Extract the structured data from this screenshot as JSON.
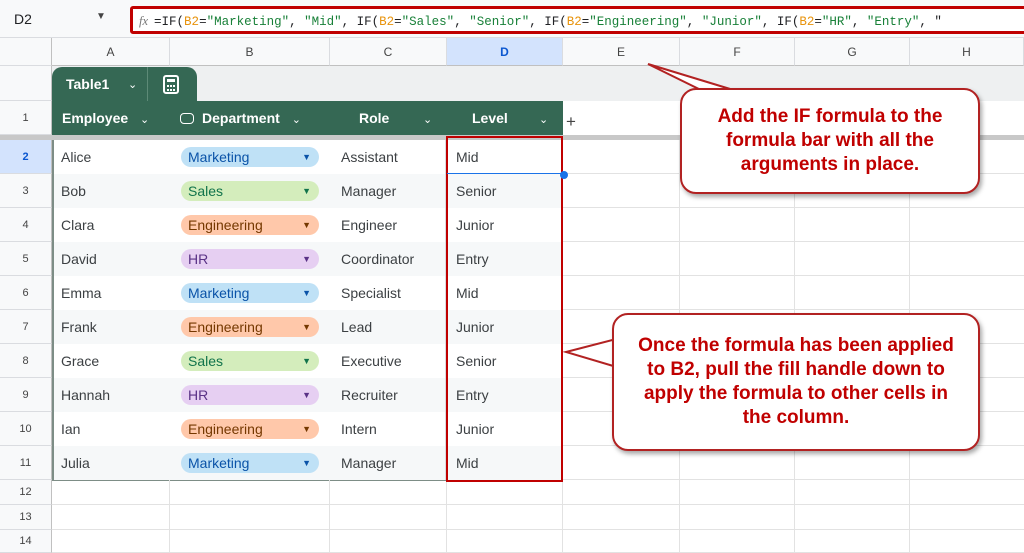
{
  "name_box": "D2",
  "formula": [
    [
      "t",
      "=IF("
    ],
    [
      "r",
      "B2"
    ],
    [
      "t",
      "="
    ],
    [
      "s",
      "\"Marketing\""
    ],
    [
      "t",
      ", "
    ],
    [
      "s",
      "\"Mid\""
    ],
    [
      "t",
      ", IF("
    ],
    [
      "r",
      "B2"
    ],
    [
      "t",
      "="
    ],
    [
      "s",
      "\"Sales\""
    ],
    [
      "t",
      ", "
    ],
    [
      "s",
      "\"Senior\""
    ],
    [
      "t",
      ", IF("
    ],
    [
      "r",
      "B2"
    ],
    [
      "t",
      "="
    ],
    [
      "s",
      "\"Engineering\""
    ],
    [
      "t",
      ", "
    ],
    [
      "s",
      "\"Junior\""
    ],
    [
      "t",
      ", IF("
    ],
    [
      "r",
      "B2"
    ],
    [
      "t",
      "="
    ],
    [
      "s",
      "\"HR\""
    ],
    [
      "t",
      ", "
    ],
    [
      "s",
      "\"Entry\""
    ],
    [
      "t",
      ", \""
    ]
  ],
  "fx_label": "fx",
  "columns": [
    "A",
    "B",
    "C",
    "D",
    "E",
    "F",
    "G",
    "H"
  ],
  "table_name": "Table1",
  "headers": [
    "Employee",
    "Department",
    "Role",
    "Level"
  ],
  "add_column": "+",
  "rows": [
    {
      "n": "2",
      "employee": "Alice",
      "dept": "Marketing",
      "role": "Assistant",
      "level": "Mid"
    },
    {
      "n": "3",
      "employee": "Bob",
      "dept": "Sales",
      "role": "Manager",
      "level": "Senior"
    },
    {
      "n": "4",
      "employee": "Clara",
      "dept": "Engineering",
      "role": "Engineer",
      "level": "Junior"
    },
    {
      "n": "5",
      "employee": "David",
      "dept": "HR",
      "role": "Coordinator",
      "level": "Entry"
    },
    {
      "n": "6",
      "employee": "Emma",
      "dept": "Marketing",
      "role": "Specialist",
      "level": "Mid"
    },
    {
      "n": "7",
      "employee": "Frank",
      "dept": "Engineering",
      "role": "Lead",
      "level": "Junior"
    },
    {
      "n": "8",
      "employee": "Grace",
      "dept": "Sales",
      "role": "Executive",
      "level": "Senior"
    },
    {
      "n": "9",
      "employee": "Hannah",
      "dept": "HR",
      "role": "Recruiter",
      "level": "Entry"
    },
    {
      "n": "10",
      "employee": "Ian",
      "dept": "Engineering",
      "role": "Intern",
      "level": "Junior"
    },
    {
      "n": "11",
      "employee": "Julia",
      "dept": "Marketing",
      "role": "Manager",
      "level": "Mid"
    }
  ],
  "empty_rows": [
    "12",
    "13",
    "14"
  ],
  "chip_colors": {
    "Marketing": {
      "bg": "#bfe1f6",
      "fg": "#0a53a8"
    },
    "Sales": {
      "bg": "#d4edbc",
      "fg": "#11734b"
    },
    "Engineering": {
      "bg": "#ffc8aa",
      "fg": "#753800"
    },
    "HR": {
      "bg": "#e6cff2",
      "fg": "#5a3286"
    }
  },
  "callouts": {
    "top": "Add the IF formula to the formula bar with all the arguments in place.",
    "bottom": "Once the formula has been applied to B2, pull the fill handle down to apply the formula to other cells in the column."
  }
}
